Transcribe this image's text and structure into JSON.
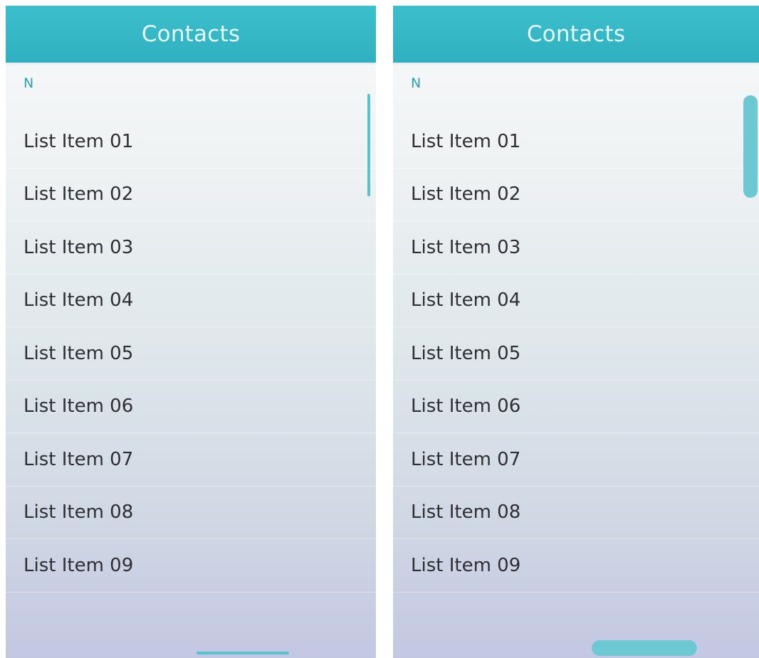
{
  "left_screen": {
    "header": {
      "title": "Contacts"
    },
    "section_index": "N",
    "items": [
      {
        "label": "List Item 01"
      },
      {
        "label": "List Item 02"
      },
      {
        "label": "List Item 03"
      },
      {
        "label": "List Item 04"
      },
      {
        "label": "List Item 05"
      },
      {
        "label": "List Item 06"
      },
      {
        "label": "List Item 07"
      },
      {
        "label": "List Item 08"
      },
      {
        "label": "List Item 09"
      }
    ],
    "scrollbar_state": "thin"
  },
  "right_screen": {
    "header": {
      "title": "Contacts"
    },
    "section_index": "N",
    "items": [
      {
        "label": "List Item 01"
      },
      {
        "label": "List Item 02"
      },
      {
        "label": "List Item 03"
      },
      {
        "label": "List Item 04"
      },
      {
        "label": "List Item 05"
      },
      {
        "label": "List Item 06"
      },
      {
        "label": "List Item 07"
      },
      {
        "label": "List Item 08"
      },
      {
        "label": "List Item 09"
      }
    ],
    "scrollbar_state": "thick"
  },
  "colors": {
    "header_teal": "#34b6c5",
    "accent_text": "#2aa2b4",
    "scrollbar": "#6cc9d4",
    "item_text": "#2f2f33"
  }
}
